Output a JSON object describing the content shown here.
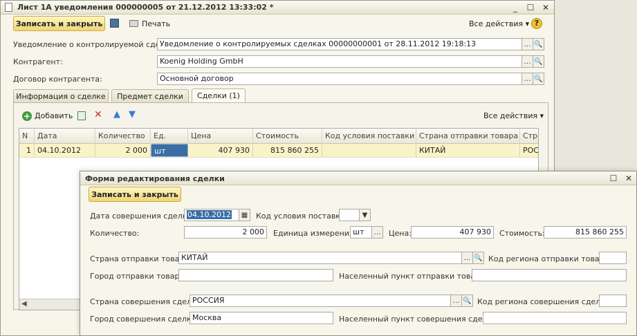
{
  "main": {
    "title": "Лист 1А уведомления 000000005 от 21.12.2012 13:33:02 *",
    "toolbar": {
      "save_close": "Записать и закрыть",
      "print": "Печать",
      "all_actions": "Все действия ▾",
      "help": "?"
    },
    "fields": {
      "notice_label": "Уведомление о контролируемой сделке:",
      "notice_value": "Уведомление о контролируемых сделках 00000000001 от 28.11.2012 19:18:13",
      "counterparty_label": "Контрагент:",
      "counterparty_value": "Koenig Holding GmbH",
      "contract_label": "Договор контрагента:",
      "contract_value": "Основной договор"
    },
    "tabs": [
      "Информация о сделке",
      "Предмет сделки",
      "Сделки (1)"
    ],
    "grid_toolbar": {
      "add": "Добавить",
      "all_actions": "Все действия ▾"
    },
    "grid": {
      "headers": [
        "N",
        "Дата",
        "Количество",
        "Ед.",
        "Цена",
        "Стоимость",
        "Код условия поставки",
        "Страна отправки товара",
        "Стра"
      ],
      "rows": [
        [
          "1",
          "04.10.2012",
          "2 000",
          "шт",
          "407 930",
          "815 860 255",
          "",
          "КИТАЙ",
          "РОС"
        ]
      ]
    }
  },
  "edit_form": {
    "title": "Форма редактирования сделки",
    "save_close": "Записать и закрыть",
    "labels": {
      "date": "Дата совершения сделки:",
      "delivery_code": "Код условия поставки:",
      "qty": "Количество:",
      "unit": "Единица измерения:",
      "price": "Цена:",
      "cost": "Стоимость:",
      "ship_country": "Страна отправки товара:",
      "ship_region": "Код региона отправки товара:",
      "ship_city": "Город отправки товара:",
      "ship_locality": "Населенный пункт отправки товара:",
      "deal_country": "Страна совершения сделки:",
      "deal_region": "Код региона совершения сделки:",
      "deal_city": "Город совершения сделки:",
      "deal_locality": "Населенный пункт совершения сделки:"
    },
    "values": {
      "date": "04.10.2012",
      "delivery_code": "",
      "qty": "2 000",
      "unit": "шт",
      "price": "407 930",
      "cost": "815 860 255",
      "ship_country": "КИТАЙ",
      "ship_region": "",
      "ship_city": "",
      "ship_locality": "",
      "deal_country": "РОССИЯ",
      "deal_region": "",
      "deal_city": "Москва",
      "deal_locality": ""
    }
  },
  "icons": {
    "ellipsis": "...",
    "search": "magnifier-icon",
    "colors": {
      "accent_yellow": "#f0d576",
      "selection": "#3a6ea5",
      "row_highlight": "#fbf3c8"
    }
  }
}
